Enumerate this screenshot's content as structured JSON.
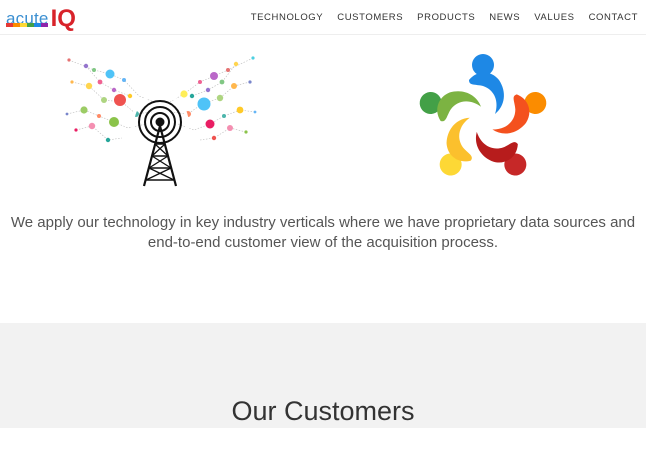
{
  "logo": {
    "acute": "acute",
    "iq": "IQ",
    "bar_colors": [
      "#e53935",
      "#fb8c00",
      "#fdd835",
      "#43a047",
      "#1e88e5",
      "#8e24aa"
    ]
  },
  "nav": [
    "TECHNOLOGY",
    "CUSTOMERS",
    "PRODUCTS",
    "NEWS",
    "VALUES",
    "CONTACT"
  ],
  "intro": "We apply our technology in key industry verticals where we have proprietary data sources and end-to-end customer view of the acquisition process.",
  "section_title": "Our Customers",
  "colors": {
    "accent_red": "#d8232a",
    "accent_blue": "#3b8fd1",
    "band_gray": "#f2f2f2",
    "text": "#555555"
  }
}
